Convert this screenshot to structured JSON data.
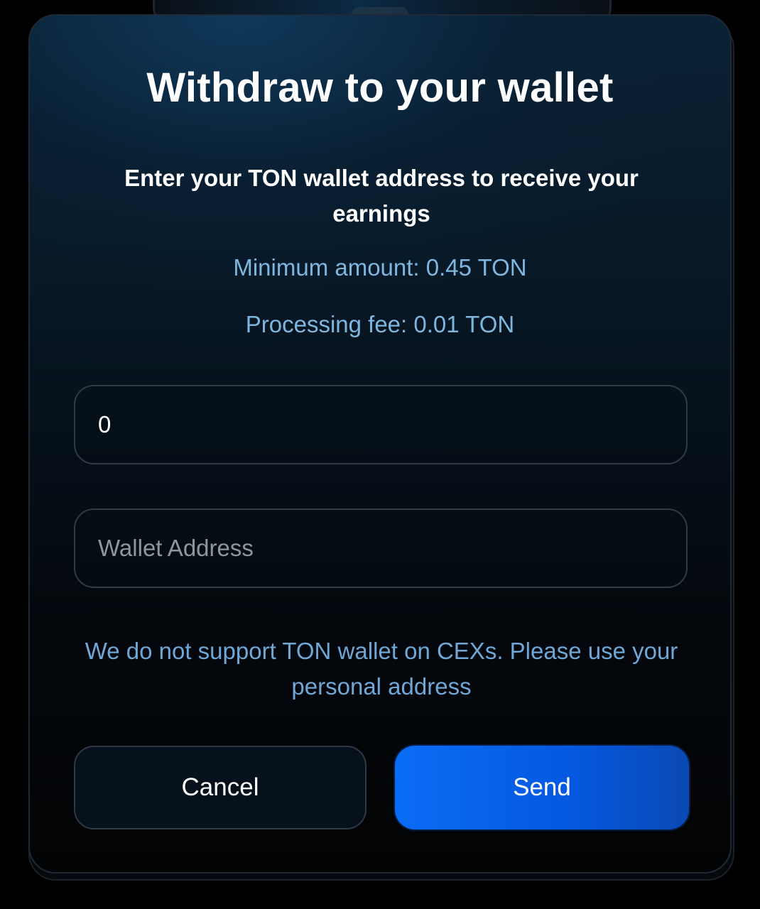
{
  "modal": {
    "title": "Withdraw to your wallet",
    "subtitle": "Enter your TON wallet address to receive your earnings",
    "minimum_amount": "Minimum amount: 0.45 TON",
    "processing_fee": "Processing fee: 0.01 TON",
    "amount_input": {
      "value": "0",
      "placeholder": ""
    },
    "wallet_input": {
      "value": "",
      "placeholder": "Wallet Address"
    },
    "note": "We do not support TON wallet on CEXs. Please use your personal address",
    "cancel_label": "Cancel",
    "send_label": "Send"
  },
  "colors": {
    "accent": "#0a6cf5",
    "info_text": "#7fb6df",
    "background": "#000000"
  }
}
